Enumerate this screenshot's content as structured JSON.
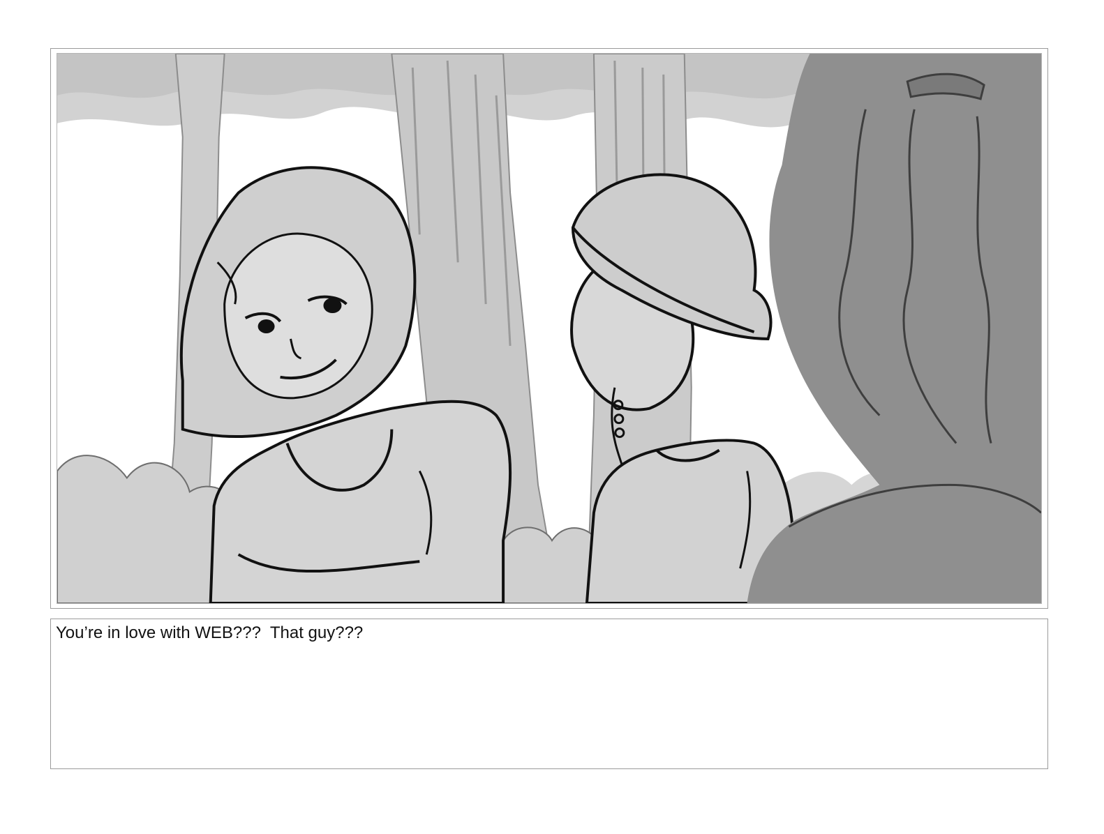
{
  "storyboard": {
    "panel": {
      "background_color": "#ffffff",
      "line_color": "#111111",
      "light_gray": "#d0d0d0",
      "mid_gray": "#bdbdbd",
      "dark_gray": "#8e8e8e"
    },
    "caption": {
      "text": "You’re in love with WEB???  That guy???"
    }
  }
}
